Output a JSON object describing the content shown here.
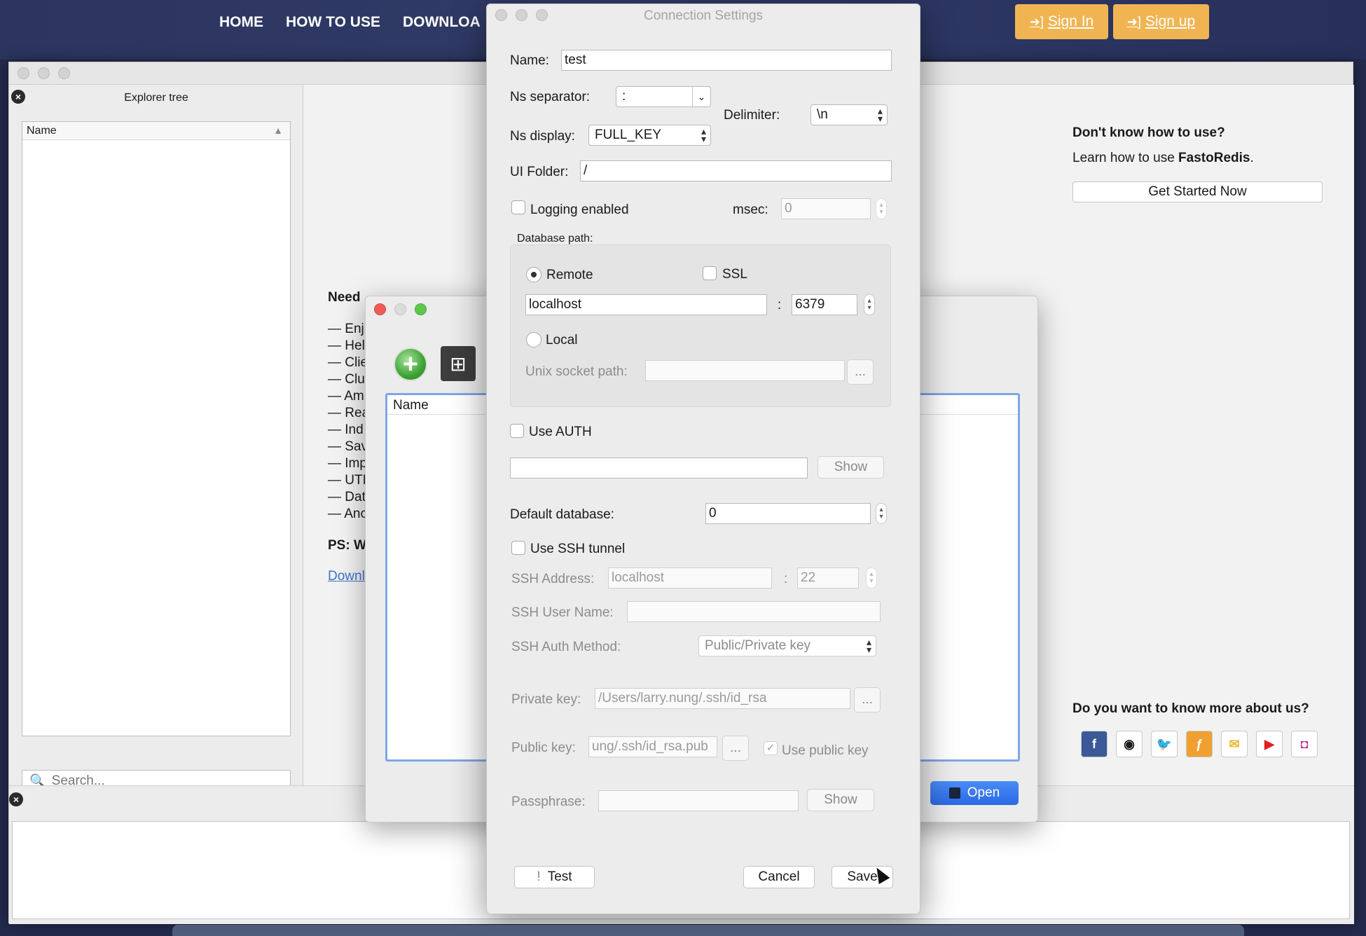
{
  "site": {
    "nav": [
      "HOME",
      "HOW TO USE",
      "DOWNLOA"
    ],
    "sign_in": "Sign In",
    "sign_up": "Sign up",
    "accent": "#f0b552"
  },
  "main_window": {
    "explorer": {
      "title": "Explorer tree",
      "column": "Name",
      "search_placeholder": "Search..."
    },
    "welcome": {
      "question": "Don't know how to use?",
      "learn_prefix": "Learn how to use ",
      "brand": "FastoRedis",
      "learn_suffix": ".",
      "get_started": "Get Started Now",
      "about": "Do you want to know more about us?",
      "social_icons": [
        "facebook-icon",
        "github-icon",
        "twitter-icon",
        "fastogt-icon",
        "email-icon",
        "youtube-icon",
        "instagram-icon"
      ]
    },
    "need_block": {
      "heading": "Need",
      "items": [
        "— Enj",
        "— Hel",
        "— Clie",
        "— Clu",
        "— Am",
        "— Rea",
        "— Ind",
        "— Sav",
        "— Imp",
        "— UTI",
        "— Dat",
        "— Anc"
      ],
      "ps": "PS: W",
      "download_link": "Downl"
    }
  },
  "connections_window": {
    "list_column": "Name",
    "open_label": "Open"
  },
  "dialog": {
    "title": "Connection Settings",
    "name_label": "Name:",
    "name_value": "test",
    "ns_separator_label": "Ns separator:",
    "ns_separator_value": ":",
    "delimiter_label": "Delimiter:",
    "delimiter_value": "\\n",
    "ns_display_label": "Ns display:",
    "ns_display_value": "FULL_KEY",
    "ui_folder_label": "UI Folder:",
    "ui_folder_value": "/",
    "logging_label": "Logging enabled",
    "msec_label": "msec:",
    "msec_value": "0",
    "db_path_label": "Database path:",
    "remote_label": "Remote",
    "ssl_label": "SSL",
    "host_value": "localhost",
    "port_sep": ":",
    "port_value": "6379",
    "local_label": "Local",
    "unix_socket_label": "Unix socket path:",
    "browse": "...",
    "use_auth_label": "Use AUTH",
    "show_label": "Show",
    "default_db_label": "Default database:",
    "default_db_value": "0",
    "use_ssh_label": "Use SSH tunnel",
    "ssh_address_label": "SSH Address:",
    "ssh_address_value": "localhost",
    "ssh_port_value": "22",
    "ssh_user_label": "SSH User Name:",
    "ssh_auth_label": "SSH Auth Method:",
    "ssh_auth_value": "Public/Private key",
    "private_key_label": "Private key:",
    "private_key_value": "/Users/larry.nung/.ssh/id_rsa",
    "public_key_label": "Public key:",
    "public_key_value": "ung/.ssh/id_rsa.pub",
    "use_public_key_label": "Use public key",
    "passphrase_label": "Passphrase:",
    "test_label": "Test",
    "cancel_label": "Cancel",
    "save_label": "Save"
  }
}
